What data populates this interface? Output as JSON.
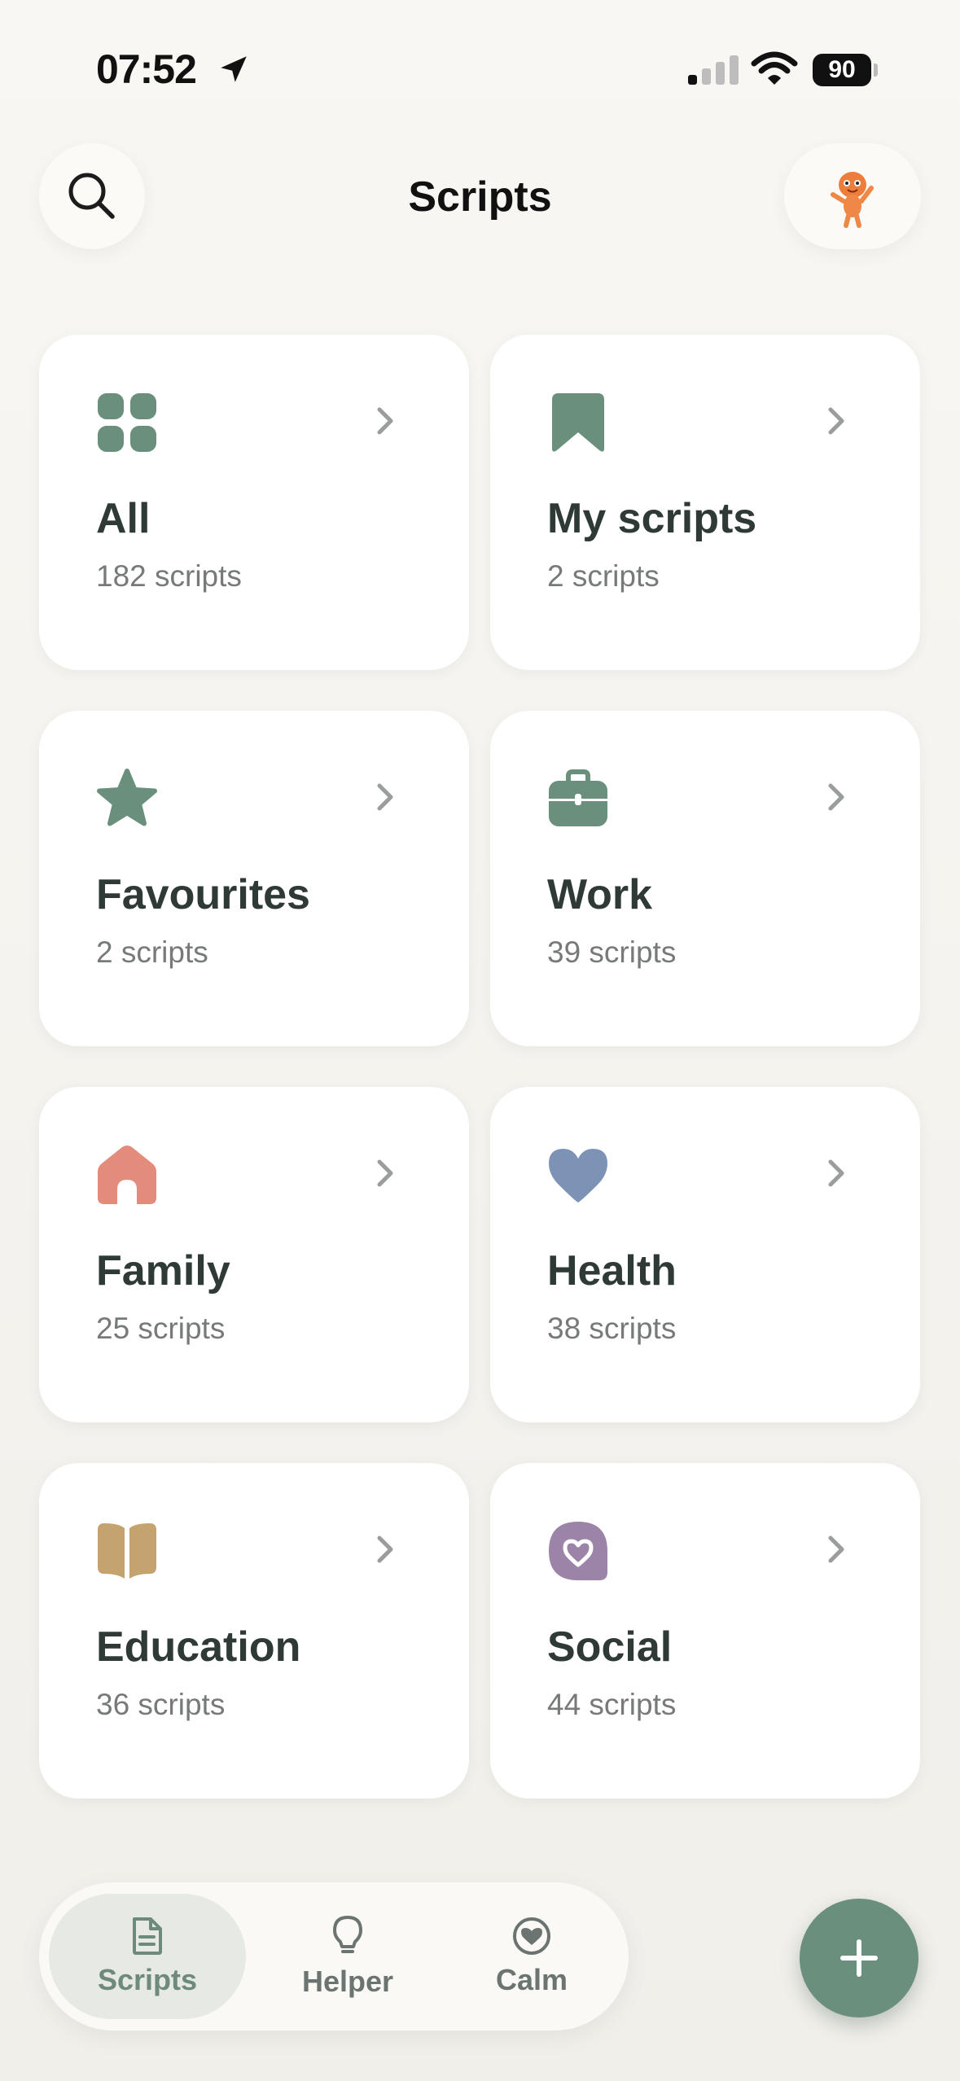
{
  "status_bar": {
    "time": "07:52",
    "battery": "90"
  },
  "header": {
    "title": "Scripts"
  },
  "categories": [
    {
      "title": "All",
      "count": "182 scripts",
      "icon": "grid-icon",
      "color": "#6a8f7c"
    },
    {
      "title": "My scripts",
      "count": "2 scripts",
      "icon": "bookmark-icon",
      "color": "#6a8f7c"
    },
    {
      "title": "Favourites",
      "count": "2 scripts",
      "icon": "star-icon",
      "color": "#6a8f7c"
    },
    {
      "title": "Work",
      "count": "39 scripts",
      "icon": "briefcase-icon",
      "color": "#6a8f7c"
    },
    {
      "title": "Family",
      "count": "25 scripts",
      "icon": "house-icon",
      "color": "#e48c7c"
    },
    {
      "title": "Health",
      "count": "38 scripts",
      "icon": "heart-icon",
      "color": "#7d93b5"
    },
    {
      "title": "Education",
      "count": "36 scripts",
      "icon": "book-icon",
      "color": "#c4a36e"
    },
    {
      "title": "Social",
      "count": "44 scripts",
      "icon": "heart-bubble-icon",
      "color": "#9b84a8"
    }
  ],
  "bottom_nav": {
    "items": [
      {
        "label": "Scripts",
        "icon": "document-icon",
        "active": true
      },
      {
        "label": "Helper",
        "icon": "lightbulb-icon",
        "active": false
      },
      {
        "label": "Calm",
        "icon": "heart-circle-icon",
        "active": false
      }
    ],
    "fab_icon": "plus-icon"
  },
  "colors": {
    "accent": "#6a8f7c",
    "background": "#f5f3ef"
  }
}
